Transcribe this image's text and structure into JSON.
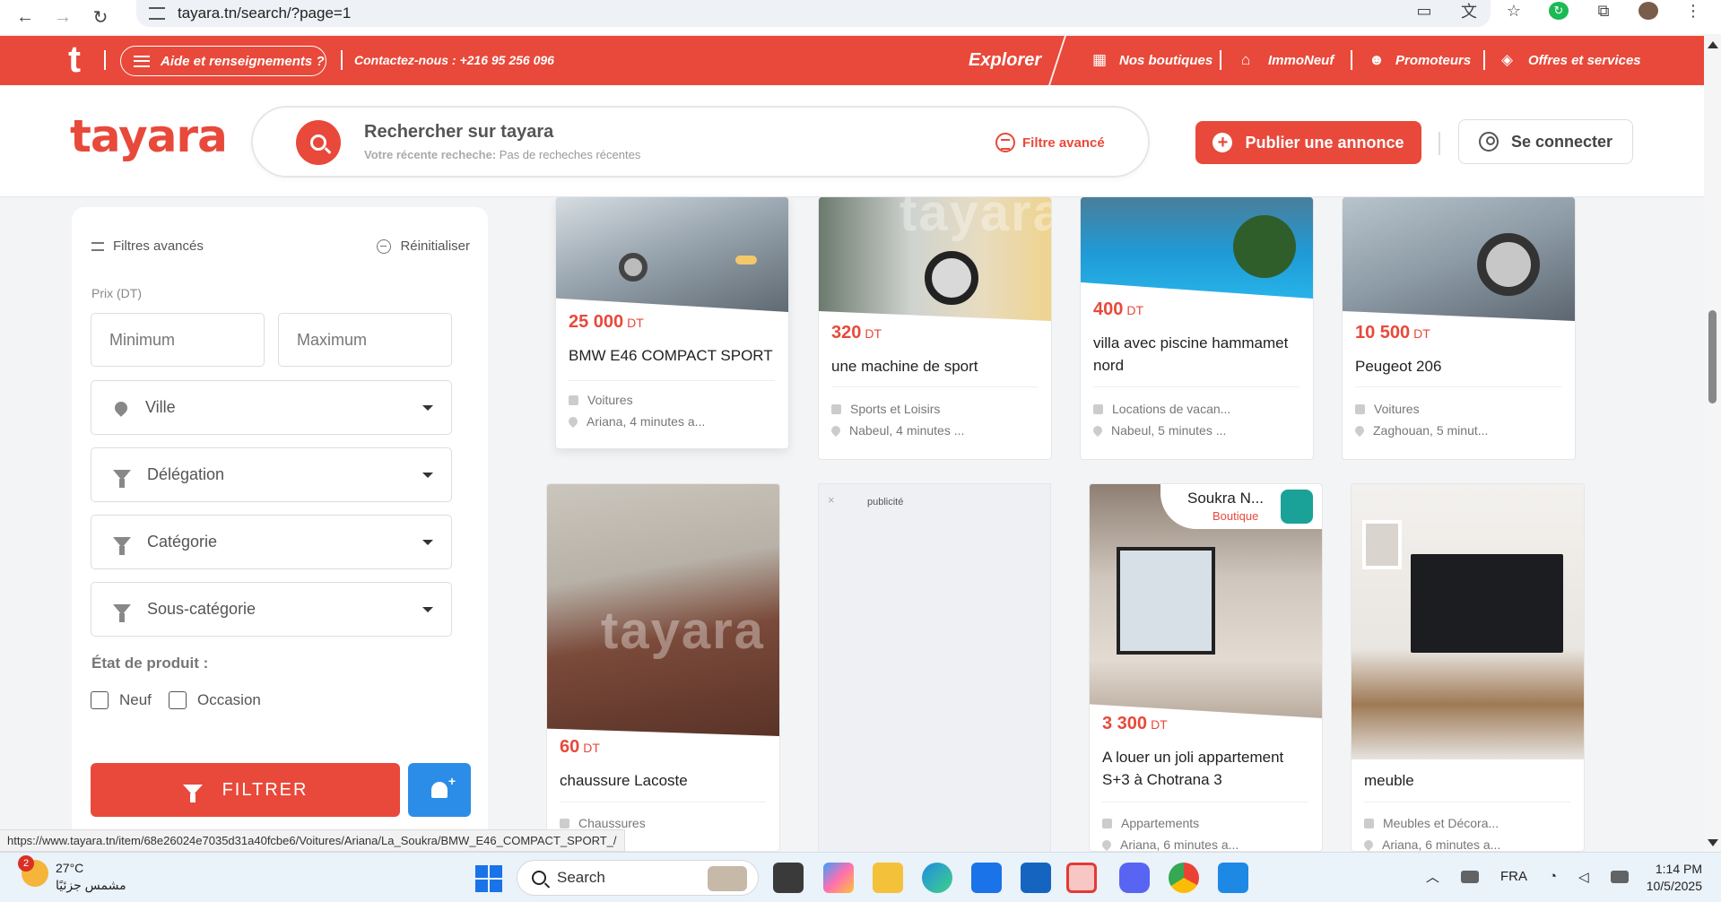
{
  "browser": {
    "url": "tayara.tn/search/?page=1",
    "status_url": "https://www.tayara.tn/item/68e26024e7035d31a40fcbe6/Voitures/Ariana/La_Soukra/BMW_E46_COMPACT_SPORT_/"
  },
  "topbar": {
    "logo_letter": "t",
    "help": "Aide et renseignements ?",
    "contact": "Contactez-nous : +216 95 256 096",
    "explorer": "Explorer",
    "links": [
      "Nos boutiques",
      "ImmoNeuf",
      "Promoteurs",
      "Offres et services"
    ]
  },
  "header": {
    "logo": "tayara",
    "search_placeholder": "Rechercher sur tayara",
    "recent_label": "Votre récente recheche:",
    "recent_value": "Pas de recheches récentes",
    "advanced_filter": "Filtre avancé",
    "publish": "Publier une annonce",
    "login": "Se connecter"
  },
  "sidebar": {
    "title": "Filtres avancés",
    "reset": "Réinitialiser",
    "price_label": "Prix (DT)",
    "min_placeholder": "Minimum",
    "max_placeholder": "Maximum",
    "selects": [
      "Ville",
      "Délégation",
      "Catégorie",
      "Sous-catégorie"
    ],
    "condition_label": "État de produit :",
    "conditions": [
      "Neuf",
      "Occasion"
    ],
    "filter_button": "FILTRER"
  },
  "currency": "DT",
  "listings": [
    {
      "price": "25 000",
      "title": "BMW E46 COMPACT SPORT",
      "category": "Voitures",
      "location": "Ariana, 4 minutes a..."
    },
    {
      "price": "320",
      "title": "une machine de sport",
      "category": "Sports et Loisirs",
      "location": "Nabeul, 4 minutes ..."
    },
    {
      "price": "400",
      "title": "villa avec piscine hammamet nord",
      "category": "Locations de vacan...",
      "location": "Nabeul, 5 minutes ..."
    },
    {
      "price": "10 500",
      "title": "Peugeot 206",
      "category": "Voitures",
      "location": "Zaghouan, 5 minut..."
    },
    {
      "price": "60",
      "title": "chaussure Lacoste",
      "category": "Chaussures",
      "location": ""
    },
    {
      "price": "3 300",
      "title": "A louer un joli appartement S+3 à Chotrana 3",
      "category": "Appartements",
      "location": "Ariana, 6 minutes a...",
      "shop_name": "Soukra N...",
      "shop_label": "Boutique"
    },
    {
      "price": "",
      "title": "meuble",
      "category": "Meubles et Décora...",
      "location": "Ariana, 6 minutes a..."
    }
  ],
  "ad": {
    "close": "×",
    "label": "publicité"
  },
  "watermark": "tayara",
  "taskbar": {
    "temperature": "27°C",
    "weather": "مشمس جزئيًا",
    "weather_badge": "2",
    "search": "Search",
    "language": "FRA",
    "time": "1:14 PM",
    "date": "10/5/2025"
  },
  "colors": {
    "brand_red": "#e8493a",
    "bell_blue": "#2b8de8"
  }
}
